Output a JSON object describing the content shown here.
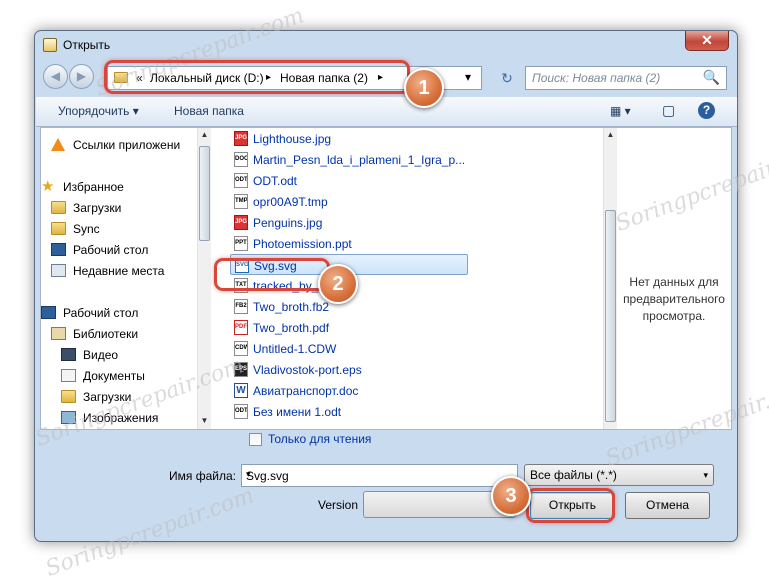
{
  "window": {
    "title": "Открыть",
    "close_glyph": "✕",
    "back_icon": "back-arrow-icon",
    "forward_icon": "forward-arrow-icon"
  },
  "address": {
    "prefix": "«",
    "segments": [
      "Локальный диск (D:)",
      "Новая папка (2)"
    ],
    "separator": "▸",
    "dropdown": "▾",
    "refresh": "↻"
  },
  "search": {
    "placeholder": "Поиск: Новая папка (2)",
    "icon": "🔍"
  },
  "toolbar": {
    "organize": "Упорядочить ▾",
    "new_folder": "Новая папка",
    "view_icon": "▦ ▾",
    "pane_icon": "▢",
    "help": "?"
  },
  "nav": {
    "items": [
      {
        "label": "Ссылки приложени",
        "icon": "vlc-icon"
      },
      {
        "label": "Избранное",
        "icon": "star-icon"
      },
      {
        "label": "Загрузки",
        "icon": "downloads-folder-icon"
      },
      {
        "label": "Sync",
        "icon": "folder-icon"
      },
      {
        "label": "Рабочий стол",
        "icon": "desktop-icon"
      },
      {
        "label": "Недавние места",
        "icon": "recent-places-icon"
      },
      {
        "label": "Рабочий стол",
        "icon": "desktop-icon"
      },
      {
        "label": "Библиотеки",
        "icon": "libraries-icon"
      },
      {
        "label": "Видео",
        "icon": "video-icon"
      },
      {
        "label": "Документы",
        "icon": "documents-icon"
      },
      {
        "label": "Загрузки",
        "icon": "downloads-folder-icon"
      },
      {
        "label": "Изображения",
        "icon": "pictures-icon"
      }
    ]
  },
  "files": [
    {
      "name": "Lighthouse.jpg",
      "icon": "JPG"
    },
    {
      "name": "Martin_Pesn_lda_i_plameni_1_Igra_p...",
      "icon": "DOC"
    },
    {
      "name": "ODT.odt",
      "icon": "ODT"
    },
    {
      "name": "opr00A9T.tmp",
      "icon": "TMP"
    },
    {
      "name": "Penguins.jpg",
      "icon": "JPG"
    },
    {
      "name": "Photoemission.ppt",
      "icon": "PPT"
    },
    {
      "name": "Svg.svg",
      "icon": "SVG"
    },
    {
      "name": "tracked_by_...txt",
      "icon": "TXT"
    },
    {
      "name": "Two_broth.fb2",
      "icon": "FB2"
    },
    {
      "name": "Two_broth.pdf",
      "icon": "PDF"
    },
    {
      "name": "Untitled-1.CDW",
      "icon": "CDW"
    },
    {
      "name": "Vladivostok-port.eps",
      "icon": "EPS"
    },
    {
      "name": "Авиатранспорт.doc",
      "icon": "W"
    },
    {
      "name": "Без имени 1.odt",
      "icon": "ODT"
    }
  ],
  "selected_file_index": 6,
  "preview": {
    "text": "Нет данных для предварительного просмотра."
  },
  "readonly": {
    "label": "Только для чтения",
    "checked": false
  },
  "filename": {
    "label": "Имя файла:",
    "value": "Svg.svg",
    "dropdown": "▾"
  },
  "filter": {
    "value": "Все файлы (*.*)",
    "dropdown": "▾"
  },
  "version": {
    "label": "Version"
  },
  "buttons": {
    "open": "Открыть",
    "cancel": "Отмена"
  },
  "steps": [
    "1",
    "2",
    "3"
  ],
  "watermark": "Soringpcrepair.com",
  "colors": {
    "highlight": "#d9463b",
    "step_badge": "#d8703c",
    "link_text": "#0033aa"
  }
}
